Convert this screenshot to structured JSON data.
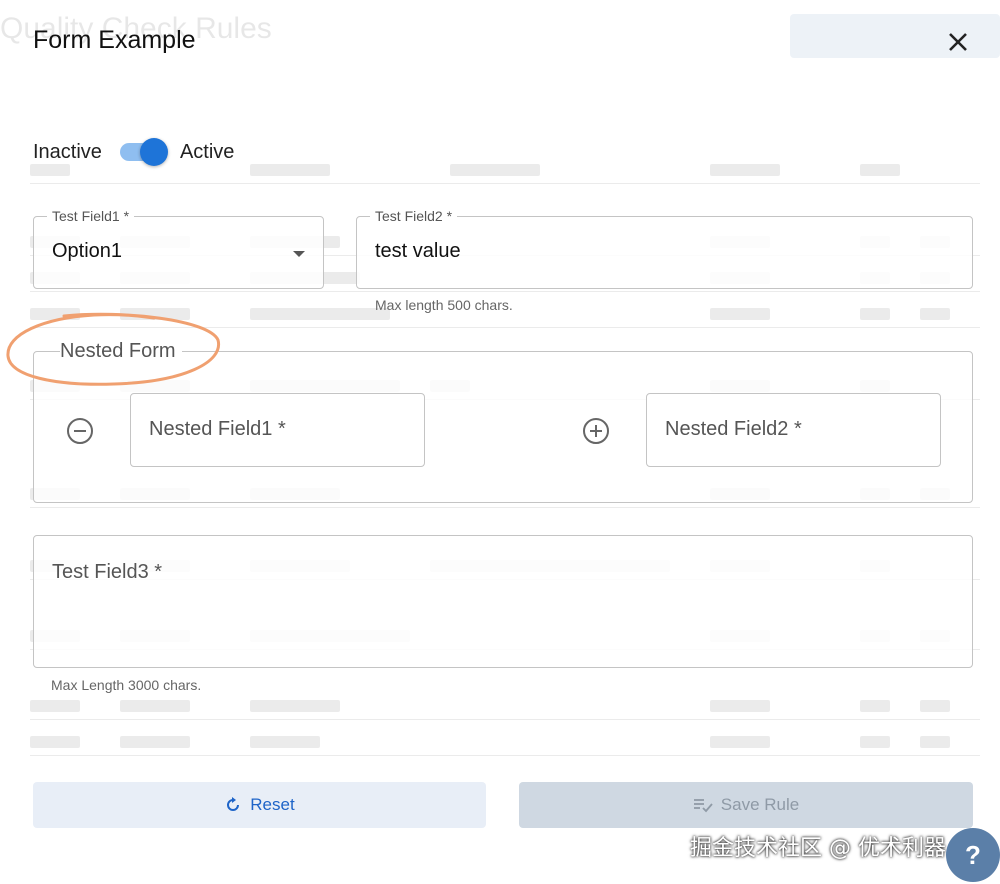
{
  "dialog": {
    "title": "Form Example",
    "close_icon": "close-icon"
  },
  "status_toggle": {
    "off_label": "Inactive",
    "on_label": "Active",
    "checked": true
  },
  "fields": {
    "field1": {
      "label": "Test Field1 *",
      "value": "Option1"
    },
    "field2": {
      "label": "Test Field2 *",
      "value": "test value",
      "helper": "Max length 500 chars."
    },
    "nested_form": {
      "label": "Nested Form",
      "field1_placeholder": "Nested Field1 *",
      "field2_placeholder": "Nested Field2 *",
      "remove_icon": "minus-circle-icon",
      "add_icon": "plus-circle-icon"
    },
    "field3": {
      "placeholder": "Test Field3 *",
      "helper": "Max Length 3000 chars."
    }
  },
  "actions": {
    "reset_label": "Reset",
    "save_label": "Save Rule"
  },
  "watermark": "掘金技术社区 @ 优术利器",
  "help_label": "?",
  "colors": {
    "accent": "#1e74d8",
    "annotation": "#f0a070",
    "reset_bg": "#e8eef7",
    "save_disabled_bg": "#cfd8e2"
  }
}
